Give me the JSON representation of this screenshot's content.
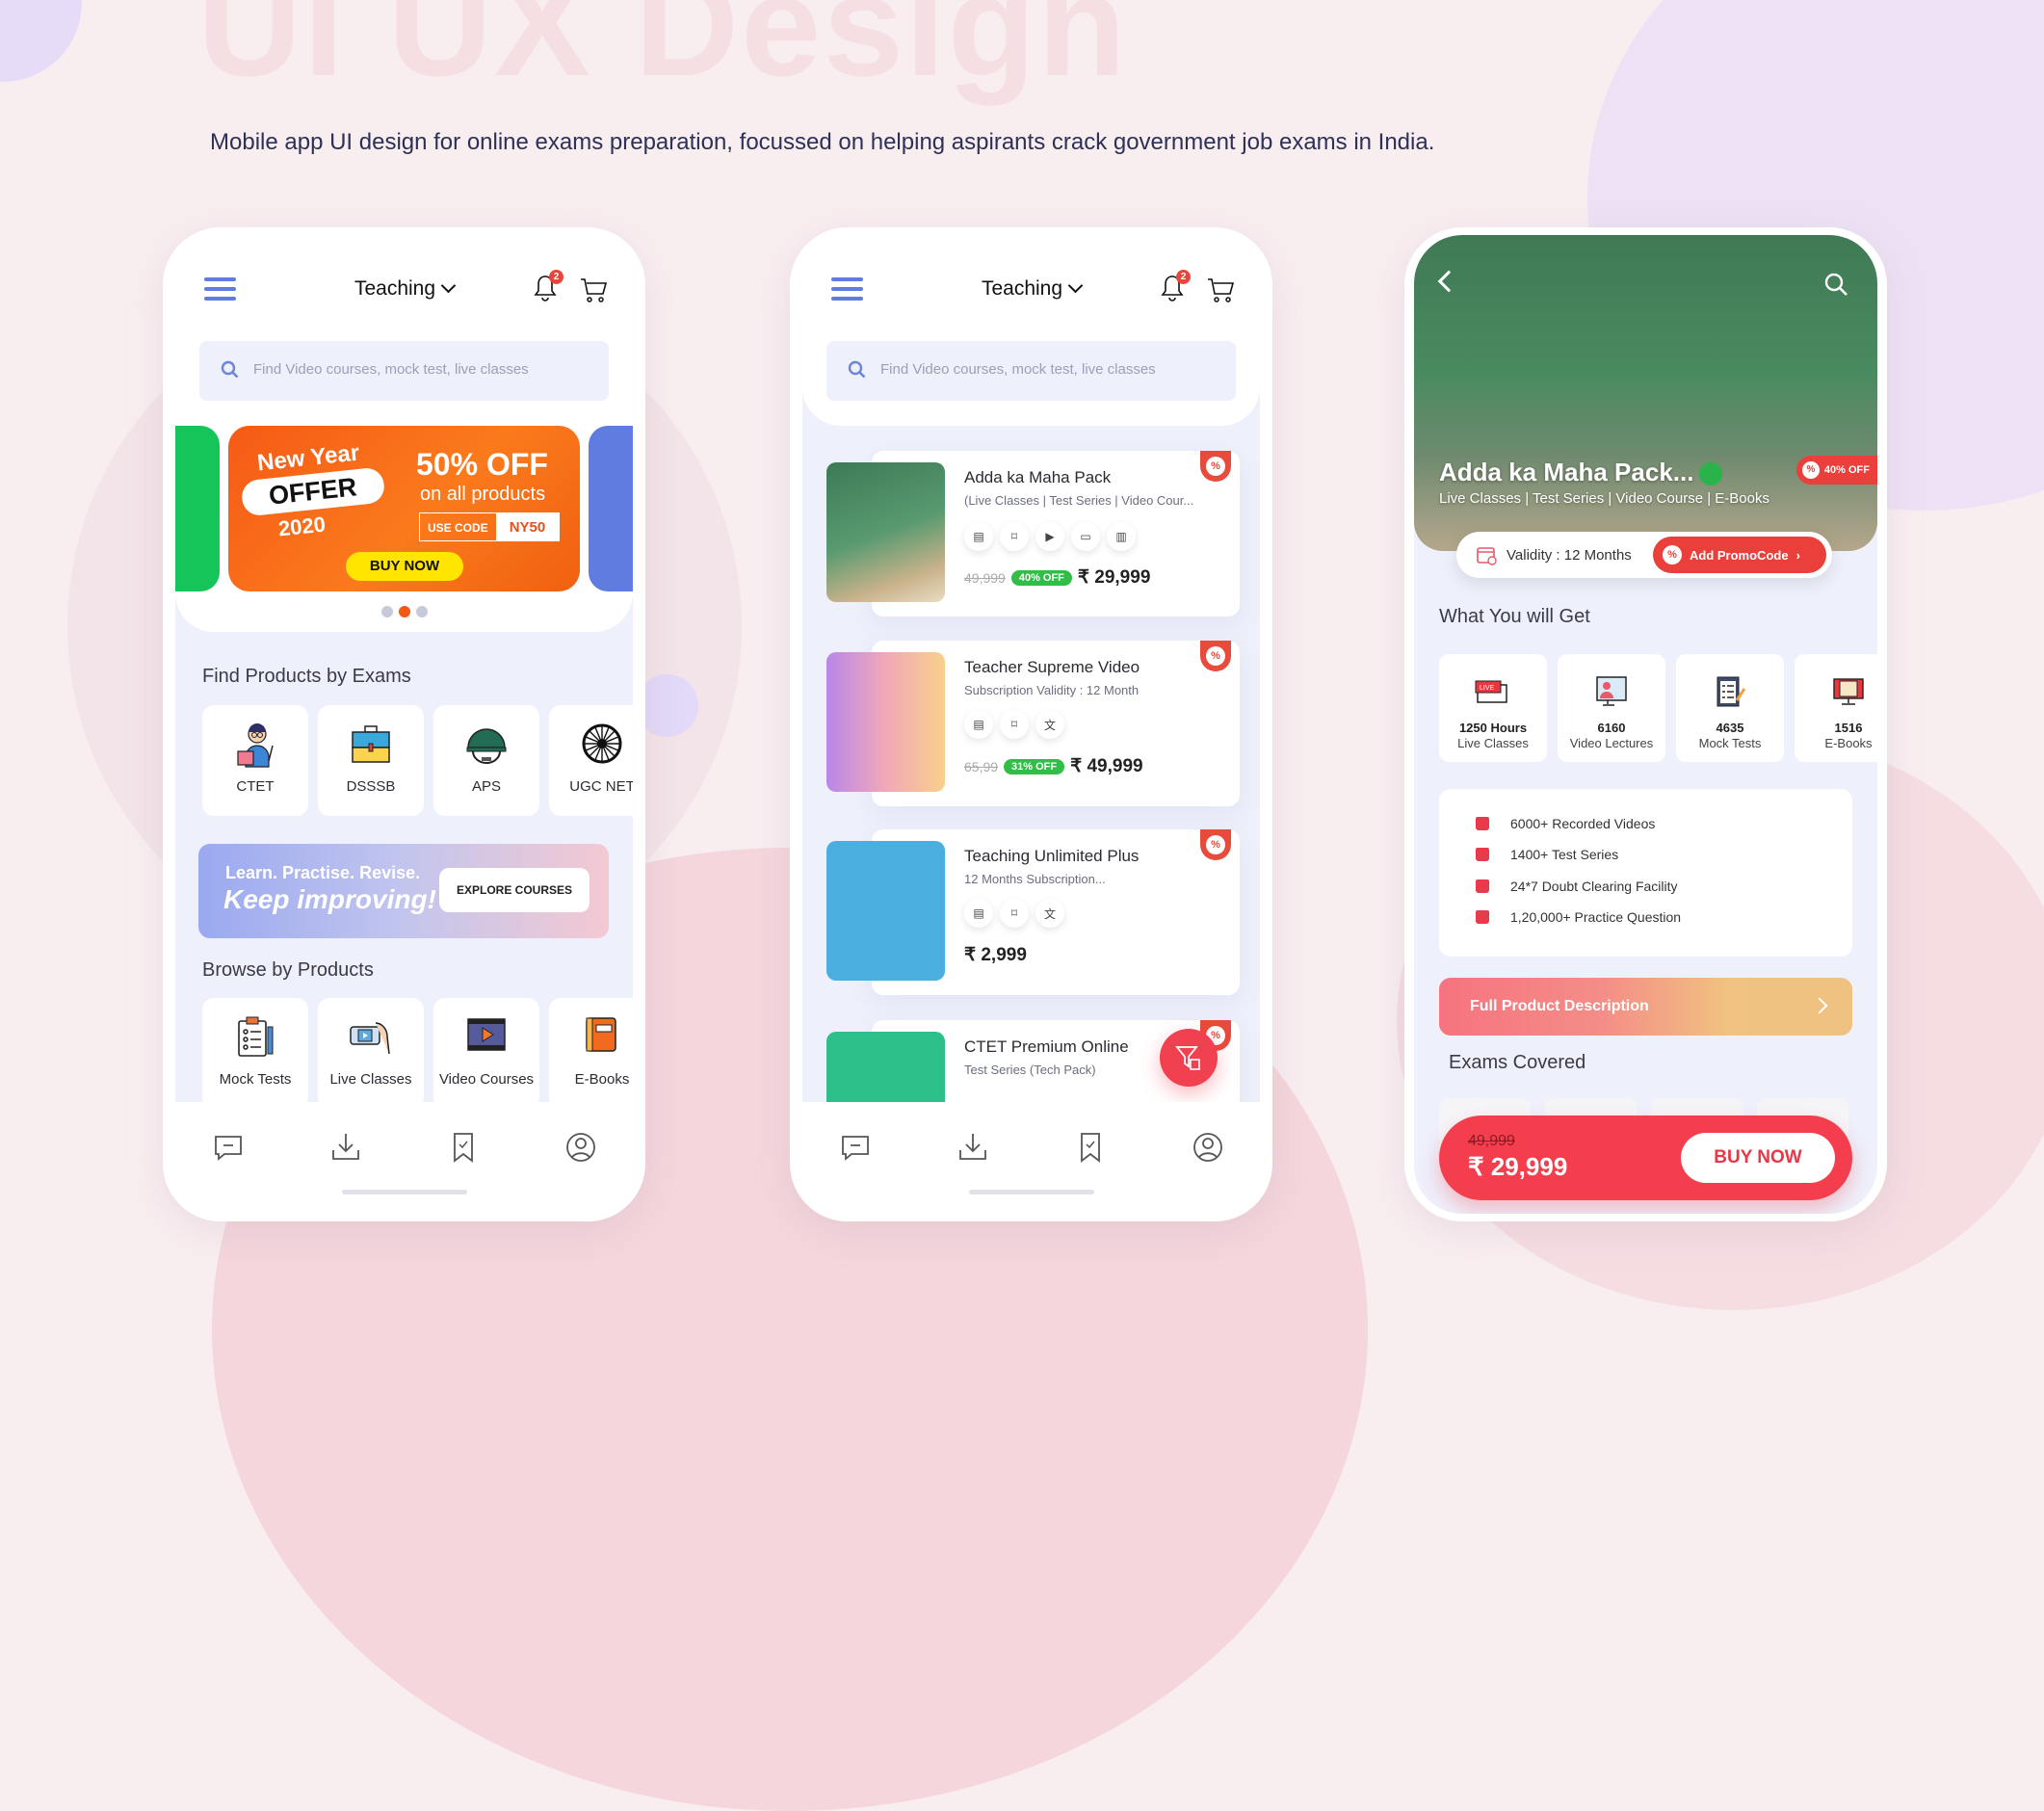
{
  "page": {
    "watermark": "UI UX Design",
    "subtitle": "Mobile app UI design for online exams preparation, focussed on helping aspirants crack government job exams in India.",
    "colors": {
      "accent_blue": "#5f7ce0",
      "accent_red": "#f53e4d",
      "offer_orange": "#f55a16",
      "discount_green": "#31be46",
      "background": "#f8eef0"
    }
  },
  "header": {
    "category": "Teaching",
    "notification_count": "2",
    "search_placeholder": "Find Video courses, mock test, live classes",
    "icons": [
      "menu-icon",
      "chevron-down-icon",
      "bell-icon",
      "cart-icon",
      "search-icon"
    ]
  },
  "home": {
    "banner": {
      "line1": "New Year",
      "line2": "OFFER",
      "line3": "2020",
      "discount": "50% OFF",
      "discount_sub": "on all products",
      "code_label": "USE CODE",
      "code": "NY50",
      "cta": "BUY NOW",
      "active_slide": 2,
      "slide_count": 3
    },
    "exams_title": "Find Products by Exams",
    "exams": [
      {
        "label": "CTET",
        "icon": "teacher-icon"
      },
      {
        "label": "DSSSB",
        "icon": "briefcase-icon"
      },
      {
        "label": "APS",
        "icon": "army-helmet-icon"
      },
      {
        "label": "UGC NET",
        "icon": "chakra-icon"
      }
    ],
    "promo": {
      "line1": "Learn. Practise. Revise.",
      "line2": "Keep improving!",
      "cta": "EXPLORE COURSES"
    },
    "products_title": "Browse by Products",
    "products": [
      {
        "label": "Mock Tests",
        "icon": "clipboard-icon"
      },
      {
        "label": "Live Classes",
        "icon": "live-video-icon"
      },
      {
        "label": "Video Courses",
        "icon": "film-icon"
      },
      {
        "label": "E-Books",
        "icon": "ebook-icon"
      }
    ]
  },
  "bottom_nav": [
    {
      "name": "chat",
      "icon": "chat-icon"
    },
    {
      "name": "downloads",
      "icon": "download-icon"
    },
    {
      "name": "saved",
      "icon": "bookmark-icon"
    },
    {
      "name": "profile",
      "icon": "profile-icon"
    }
  ],
  "listing": {
    "products": [
      {
        "title": "Adda ka Maha Pack",
        "subtitle": "(Live Classes | Test Series | Video Cour...",
        "features": [
          "test-icon",
          "bookmark-icon",
          "play-icon",
          "video-icon",
          "ebook-icon"
        ],
        "old_price": "49,999",
        "discount": "40% OFF",
        "price": "₹ 29,999"
      },
      {
        "title": "Teacher Supreme Video",
        "subtitle": "Subscription Validity : 12 Month",
        "features": [
          "test-icon",
          "bookmark-icon",
          "translate-icon"
        ],
        "old_price": "65,99",
        "discount": "31% OFF",
        "price": "₹ 49,999"
      },
      {
        "title": "Teaching Unlimited Plus",
        "subtitle": "12 Months Subscription...",
        "features": [
          "test-icon",
          "bookmark-icon",
          "translate-icon"
        ],
        "old_price": "",
        "discount": "",
        "price": "₹ 2,999"
      },
      {
        "title": "CTET Premium Online",
        "subtitle": "Test Series (Tech Pack)",
        "features": [
          "test-icon",
          "bookmark-icon",
          "translate-icon"
        ],
        "old_price": "",
        "discount": "",
        "price": ""
      }
    ],
    "fab_icon": "filter-icon"
  },
  "detail": {
    "title": "Adda ka Maha Pack...",
    "subtitle": "Live Classes | Test Series | Video Course | E-Books",
    "discount": "40% OFF",
    "validity": "Validity : 12 Months",
    "promo_cta": "Add PromoCode",
    "get_title": "What You will Get",
    "get_items": [
      {
        "value": "1250 Hours",
        "label": "Live Classes",
        "icon": "live-tv-icon"
      },
      {
        "value": "6160",
        "label": "Video Lectures",
        "icon": "video-lecture-icon"
      },
      {
        "value": "4635",
        "label": "Mock Tests",
        "icon": "checklist-icon"
      },
      {
        "value": "1516",
        "label": "E-Books",
        "icon": "ebook-icon"
      }
    ],
    "features": [
      "6000+ Recorded Videos",
      "1400+ Test Series",
      "24*7 Doubt Clearing Facility",
      "1,20,000+ Practice Question"
    ],
    "full_desc": "Full Product Description",
    "exams_title": "Exams Covered",
    "old_price": "49,999",
    "price": "₹ 29,999",
    "buy": "BUY NOW"
  }
}
